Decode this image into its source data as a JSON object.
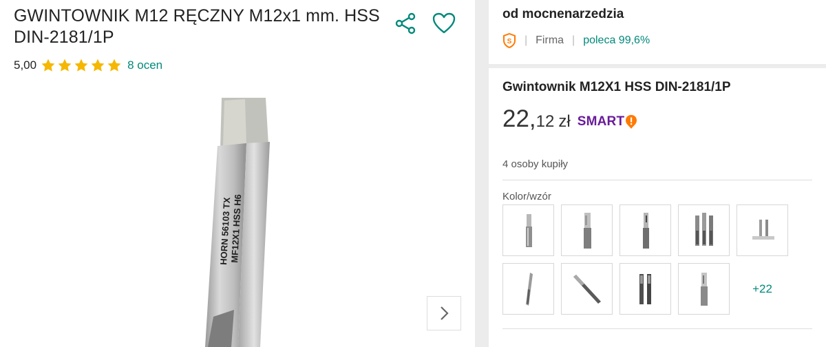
{
  "product": {
    "title": "GWINTOWNIK M12 RĘCZNY M12x1 mm. HSS DIN-2181/1P",
    "rating": "5,00",
    "stars": 5,
    "reviews_label": "8 ocen",
    "image_engraving_1": "HORN 56103 TX",
    "image_engraving_2": "MF12X1 HSS H6"
  },
  "icons": {
    "share": "share-icon",
    "favorite": "heart-icon",
    "next": "chevron-right-icon",
    "seller_badge": "super-seller-badge-icon",
    "smart_badge": "smart-badge-icon"
  },
  "seller": {
    "name": "od mocnenarzedzia",
    "type": "Firma",
    "recommend": "poleca 99,6%"
  },
  "offer": {
    "name": "Gwintownik M12X1 HSS DIN-2181/1P",
    "price_int": "22,",
    "price_frac": "12",
    "currency": "zł",
    "smart_label": "SMART",
    "bought": "4 osoby kupiły",
    "variant_label": "Kolor/wzór",
    "more_variants": "+22"
  },
  "colors": {
    "accent": "#00897b",
    "star": "#f5b700",
    "smart": "#6a1b9a",
    "smart_dot": "#ff7a00"
  }
}
